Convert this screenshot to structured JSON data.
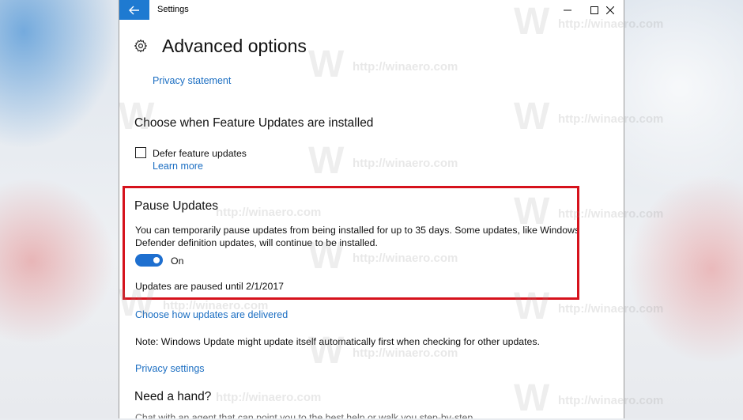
{
  "window": {
    "title": "Settings"
  },
  "page": {
    "title": "Advanced options"
  },
  "links": {
    "privacy_statement": "Privacy statement",
    "learn_more": "Learn more",
    "choose_delivery": "Choose how updates are delivered",
    "privacy_settings": "Privacy settings"
  },
  "feature_updates": {
    "heading": "Choose when Feature Updates are installed",
    "checkbox_label": "Defer feature updates",
    "checked": false
  },
  "pause_updates": {
    "heading": "Pause Updates",
    "description_line1": "You can temporarily pause updates from being installed for up to 35 days. Some updates, like Windows",
    "description_line2": "Defender definition updates, will continue to be installed.",
    "toggle_state": "On",
    "status": "Updates are paused until 2/1/2017"
  },
  "note": "Note: Windows Update might update itself automatically first when checking for other updates.",
  "help": {
    "heading": "Need a hand?",
    "text": "Chat with an agent that can point you to the best help or walk you step-by-step"
  },
  "watermark": {
    "url": "http://winaero.com",
    "logo": "W"
  },
  "colors": {
    "accent": "#1e7ad1",
    "link": "#1b6ec2",
    "highlight_border": "#d6121c"
  }
}
